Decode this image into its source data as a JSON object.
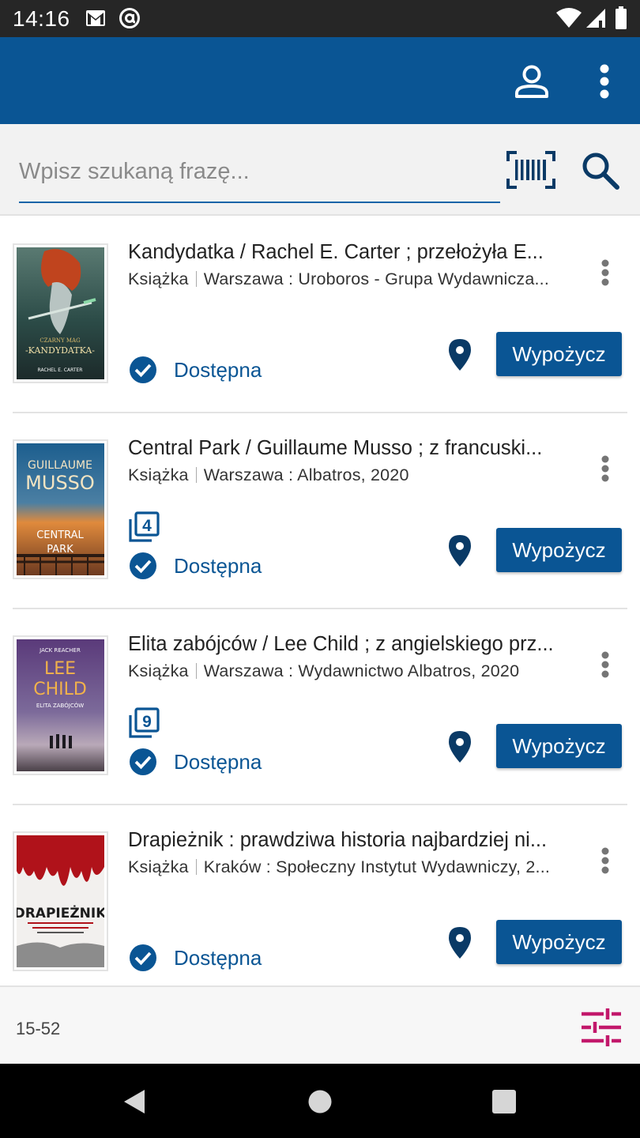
{
  "status_bar": {
    "time": "14:16",
    "icons": [
      "gmail-icon",
      "at-sign-icon",
      "wifi-icon",
      "signal-icon",
      "battery-icon"
    ]
  },
  "app_bar": {
    "background": "#0a5594",
    "actions": [
      "account-icon",
      "more-vert-icon"
    ]
  },
  "search": {
    "placeholder": "Wpisz szukaną frazę...",
    "value": "",
    "actions": [
      "barcode-scan-icon",
      "search-icon"
    ]
  },
  "results": [
    {
      "title": "Kandydatka / Rachel E. Carter ; przełożyła E...",
      "type": "Książka",
      "publication": "Warszawa : Uroboros - Grupa Wydawnicza...",
      "copies": null,
      "status": "Dostępna",
      "action": "Wypożycz",
      "cover_text": [
        "CZARNY MAG",
        "-KANDYDATKA-",
        "RACHEL E. CARTER"
      ]
    },
    {
      "title": "Central Park / Guillaume Musso ; z francuski...",
      "type": "Książka",
      "publication": "Warszawa : Albatros, 2020",
      "copies": "4",
      "status": "Dostępna",
      "action": "Wypożycz",
      "cover_text": [
        "GUILLAUME",
        "MUSSO",
        "CENTRAL",
        "PARK"
      ]
    },
    {
      "title": "Elita zabójców / Lee Child ; z angielskiego prz...",
      "type": "Książka",
      "publication": "Warszawa : Wydawnictwo Albatros, 2020",
      "copies": "9",
      "status": "Dostępna",
      "action": "Wypożycz",
      "cover_text": [
        "JACK REACHER",
        "LEE",
        "CHILD",
        "ELITA ZABÓJCÓW"
      ]
    },
    {
      "title": "Drapieżnik : prawdziwa historia najbardziej ni...",
      "type": "Książka",
      "publication": "Kraków : Społeczny Instytut Wydawniczy, 2...",
      "copies": null,
      "status": "Dostępna",
      "action": "Wypożycz",
      "cover_text": [
        "DRAPIEŻNIK"
      ]
    }
  ],
  "bottom_bar": {
    "range": "15-52",
    "filter_icon": "tune-icon",
    "filter_color": "#c2186b"
  },
  "colors": {
    "primary": "#0a5594",
    "status_bar": "#262626",
    "search_bg": "#f2f2f2"
  }
}
